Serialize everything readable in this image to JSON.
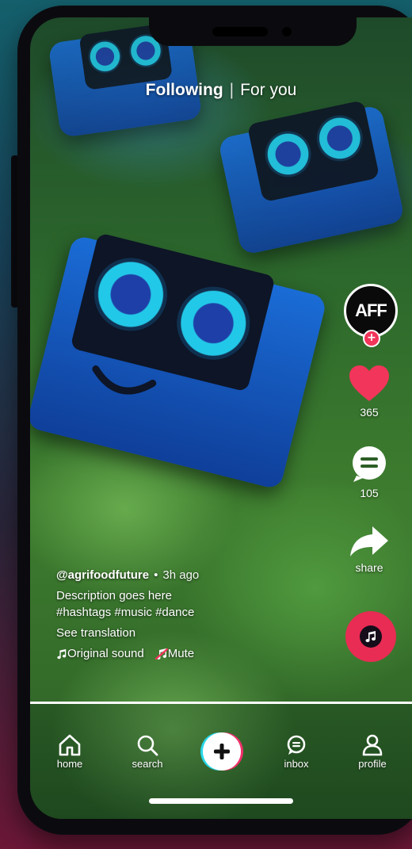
{
  "tabs": {
    "following": "Following",
    "separator": "|",
    "for_you": "For you"
  },
  "creator": {
    "avatar_text": "AFF",
    "follow_symbol": "+"
  },
  "actions": {
    "likes": "365",
    "comments": "105",
    "share": "share"
  },
  "caption": {
    "handle": "@agrifoodfuture",
    "dot": "•",
    "time": "3h ago",
    "description": "Description goes here",
    "hashtags": "#hashtags #music #dance",
    "translate": "See translation",
    "sound": "Original sound",
    "mute": "Mute"
  },
  "nav": {
    "home": "home",
    "search": "search",
    "inbox": "inbox",
    "profile": "profile"
  },
  "colors": {
    "accent": "#f2355a",
    "create_cyan": "#25d8e8",
    "create_pink": "#f0306a"
  },
  "icons": {
    "like": "heart-icon",
    "comment": "comment-icon",
    "share": "share-arrow-icon",
    "music": "music-note-icon",
    "home": "home-icon",
    "search": "search-icon",
    "create": "plus-icon",
    "inbox": "inbox-icon",
    "profile": "profile-icon"
  }
}
